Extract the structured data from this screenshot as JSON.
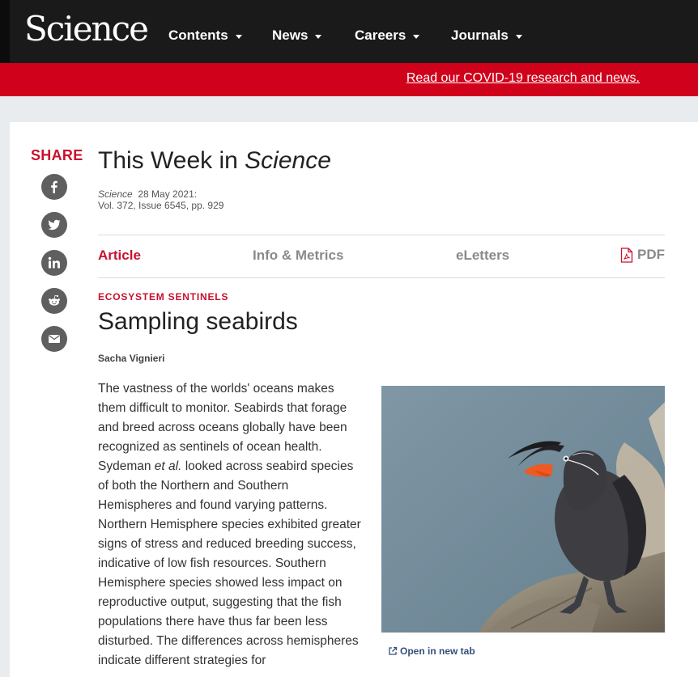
{
  "header": {
    "logo": "Science",
    "nav": [
      {
        "label": "Contents"
      },
      {
        "label": "News"
      },
      {
        "label": "Careers"
      },
      {
        "label": "Journals"
      }
    ]
  },
  "banner": {
    "link_text": "Read our COVID-19 research and news."
  },
  "share": {
    "label": "SHARE",
    "buttons": [
      "facebook-icon",
      "twitter-icon",
      "linkedin-icon",
      "reddit-icon",
      "email-icon"
    ]
  },
  "page": {
    "title_prefix": "This Week in ",
    "title_italic": "Science",
    "meta_journal": "Science",
    "meta_date": "28 May 2021:",
    "meta_issue": "Vol. 372, Issue 6545, pp. 929"
  },
  "tabs": [
    {
      "label": "Article",
      "active": true
    },
    {
      "label": "Info & Metrics",
      "active": false
    },
    {
      "label": "eLetters",
      "active": false
    }
  ],
  "pdf_label": "PDF",
  "article": {
    "section": "ECOSYSTEM SENTINELS",
    "title": "Sampling seabirds",
    "author": "Sacha Vignieri",
    "body_part1": "The vastness of the worlds' oceans makes them difficult to monitor. Seabirds that forage and breed across oceans globally have been recognized as sentinels of ocean health. Sydeman ",
    "body_italic": "et al.",
    "body_part2": " looked across seabird species of both the Northern and Southern Hemispheres and found varying patterns. Northern Hemisphere species exhibited greater signs of stress and reduced breeding success, indicative of low fish resources. Southern Hemisphere species showed less impact on reproductive output, suggesting that the fish populations there have thus far been less disturbed. The differences across hemispheres indicate different strategies for"
  },
  "figure": {
    "open_link": "Open in new tab"
  },
  "colors": {
    "accent": "#c8102e",
    "banner": "#d0021b",
    "header": "#1a1a1a",
    "link": "#33507b"
  }
}
